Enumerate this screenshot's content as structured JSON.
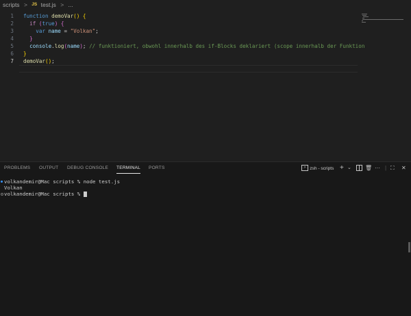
{
  "breadcrumb": {
    "folder": "scripts",
    "separator": ">",
    "file_badge": "JS",
    "file": "test.js",
    "more": "..."
  },
  "editor": {
    "active_line": 7,
    "line_numbers": [
      "1",
      "2",
      "3",
      "4",
      "5",
      "6",
      "7"
    ],
    "lines": [
      [
        {
          "t": "function ",
          "c": "kw"
        },
        {
          "t": "demoVar",
          "c": "fn"
        },
        {
          "t": "() ",
          "c": "br1"
        },
        {
          "t": "{",
          "c": "br1"
        }
      ],
      [
        {
          "t": "  ",
          "c": "plain"
        },
        {
          "t": "if ",
          "c": "kwc"
        },
        {
          "t": "(",
          "c": "br2"
        },
        {
          "t": "true",
          "c": "kw"
        },
        {
          "t": ") ",
          "c": "br2"
        },
        {
          "t": "{",
          "c": "br2"
        }
      ],
      [
        {
          "t": "    ",
          "c": "plain"
        },
        {
          "t": "var ",
          "c": "kw"
        },
        {
          "t": "name",
          "c": "var"
        },
        {
          "t": " = ",
          "c": "plain"
        },
        {
          "t": "\"Volkan\"",
          "c": "str"
        },
        {
          "t": ";",
          "c": "plain"
        }
      ],
      [
        {
          "t": "  ",
          "c": "plain"
        },
        {
          "t": "}",
          "c": "br2"
        }
      ],
      [
        {
          "t": "  ",
          "c": "plain"
        },
        {
          "t": "console",
          "c": "var"
        },
        {
          "t": ".",
          "c": "plain"
        },
        {
          "t": "log",
          "c": "fn"
        },
        {
          "t": "(",
          "c": "br2"
        },
        {
          "t": "name",
          "c": "var"
        },
        {
          "t": ")",
          "c": "br2"
        },
        {
          "t": "; ",
          "c": "plain"
        },
        {
          "t": "// funktioniert, obwohl innerhalb des if-Blocks deklariert (scope innerhalb der Funktion",
          "c": "cmt"
        }
      ],
      [
        {
          "t": "}",
          "c": "br1"
        }
      ],
      [
        {
          "t": "demoVar",
          "c": "fn"
        },
        {
          "t": "()",
          "c": "br1"
        },
        {
          "t": ";",
          "c": "plain"
        }
      ]
    ]
  },
  "panel": {
    "tabs": [
      {
        "label": "PROBLEMS",
        "active": false
      },
      {
        "label": "OUTPUT",
        "active": false
      },
      {
        "label": "DEBUG CONSOLE",
        "active": false
      },
      {
        "label": "TERMINAL",
        "active": true
      },
      {
        "label": "PORTS",
        "active": false
      }
    ],
    "terminal_name": "zsh - scripts",
    "icons": {
      "terminal": "terminal-icon",
      "add": "plus-icon",
      "dropdown": "chevron-down-icon",
      "split": "split-icon",
      "trash": "trash-icon",
      "more": "ellipsis-icon",
      "maximize": "maximize-icon",
      "close": "close-icon"
    }
  },
  "terminal": {
    "lines": [
      {
        "marker": "blue",
        "text": "volkandemir@Mac scripts % node test.js"
      },
      {
        "marker": "none",
        "text": "Volkan"
      },
      {
        "marker": "gray",
        "text": "volkandemir@Mac scripts % "
      }
    ]
  },
  "colors": {
    "editor_bg": "#1f1f1f",
    "panel_bg": "#181818",
    "keyword": "#569cd6",
    "function": "#dcdcaa",
    "string": "#ce9178",
    "comment": "#6a9955"
  }
}
